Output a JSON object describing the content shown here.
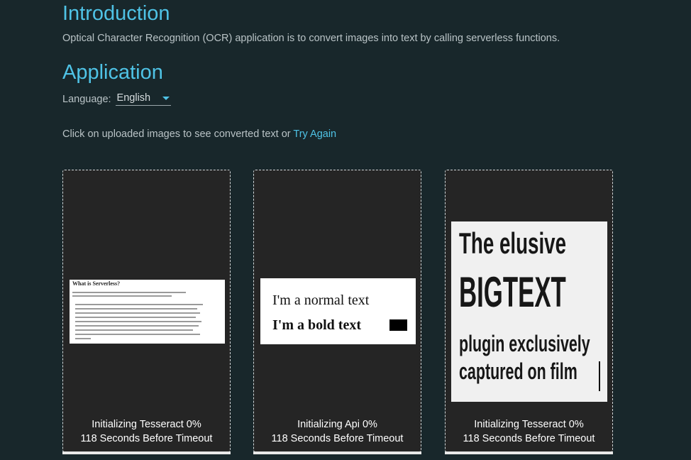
{
  "intro": {
    "title": "Introduction",
    "description": "Optical Character Recognition (OCR) application is to convert images into text by calling serverless functions."
  },
  "application": {
    "title": "Application",
    "language_label": "Language:",
    "language_value": "English",
    "instruction": "Click on uploaded images to see converted text or",
    "try_again": "Try Again"
  },
  "cards": [
    {
      "status": "Initializing Tesseract 0%",
      "timeout": "118 Seconds Before Timeout",
      "thumbnail": {
        "title": "What is Serverless?"
      }
    },
    {
      "status": "Initializing Api 0%",
      "timeout": "118 Seconds Before Timeout",
      "thumbnail": {
        "line1": "I'm a normal text",
        "line2": "I'm a bold text"
      }
    },
    {
      "status": "Initializing Tesseract 0%",
      "timeout": "118 Seconds Before Timeout",
      "thumbnail": {
        "line1": "The elusive",
        "line2": "BIGTEXT",
        "line3": "plugin exclusively",
        "line4": "captured on film"
      }
    }
  ],
  "colors": {
    "background": "#18272b",
    "accent": "#4fc3e6",
    "card": "#252525"
  }
}
